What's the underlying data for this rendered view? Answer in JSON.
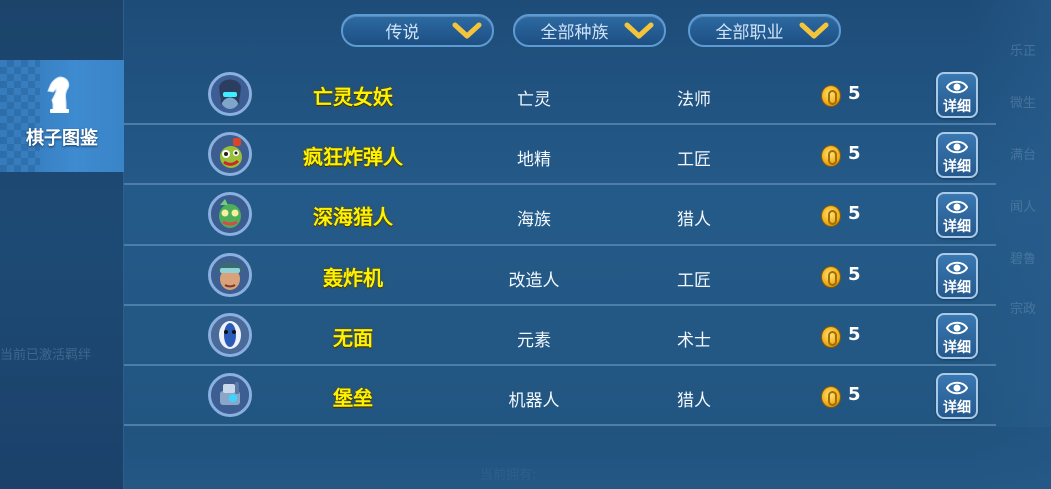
{
  "filters": [
    {
      "label": "传说",
      "id": "rarity"
    },
    {
      "label": "全部种族",
      "id": "race"
    },
    {
      "label": "全部职业",
      "id": "class"
    }
  ],
  "sidebar": {
    "tab_label": "棋子图鉴",
    "icon": "chess-knight-icon"
  },
  "pieces": [
    {
      "name": "亡灵女妖",
      "race": "亡灵",
      "class": "法师",
      "cost": "5",
      "detail_label": "详细",
      "avatar": "banshee"
    },
    {
      "name": "疯狂炸弹人",
      "race": "地精",
      "class": "工匠",
      "cost": "5",
      "detail_label": "详细",
      "avatar": "bomber"
    },
    {
      "name": "深海猎人",
      "race": "海族",
      "class": "猎人",
      "cost": "5",
      "detail_label": "详细",
      "avatar": "hunter"
    },
    {
      "name": "轰炸机",
      "race": "改造人",
      "class": "工匠",
      "cost": "5",
      "detail_label": "详细",
      "avatar": "flyer"
    },
    {
      "name": "无面",
      "race": "元素",
      "class": "术士",
      "cost": "5",
      "detail_label": "详细",
      "avatar": "faceless"
    },
    {
      "name": "堡垒",
      "race": "机器人",
      "class": "猎人",
      "cost": "5",
      "detail_label": "详细",
      "avatar": "fortress"
    }
  ],
  "colors": {
    "name_yellow": "#fff200",
    "panel_blue": "#245a89",
    "tab_blue": "#3f8bd0",
    "coin_gold": "#f2b21d"
  }
}
